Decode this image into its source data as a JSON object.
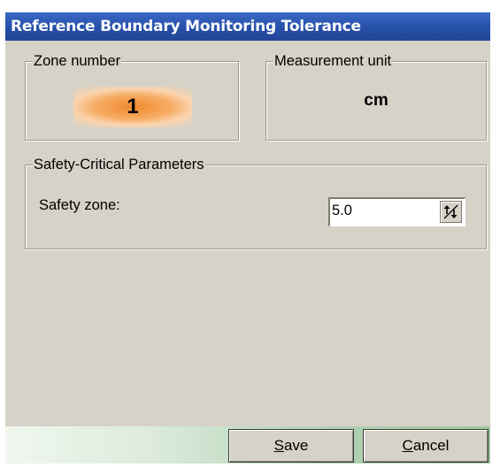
{
  "window": {
    "title": "Reference Boundary Monitoring Tolerance"
  },
  "zone": {
    "legend": "Zone number",
    "value": "1",
    "highlight_color": "#f08a2e"
  },
  "unit": {
    "legend": "Measurement unit",
    "value": "cm"
  },
  "safety_group": {
    "legend": "Safety-Critical Parameters",
    "safety_zone_label": "Safety zone:",
    "safety_zone_value": "5.0",
    "spinner_icon": "up-down-arrows-icon"
  },
  "buttons": {
    "save_mnemonic": "S",
    "save_rest": "ave",
    "cancel_mnemonic": "C",
    "cancel_rest": "ancel"
  },
  "colors": {
    "title_bar": "#2750a8",
    "dialog_bg": "#d6d2c7",
    "footer_gradient_end": "#9fc7a1"
  }
}
